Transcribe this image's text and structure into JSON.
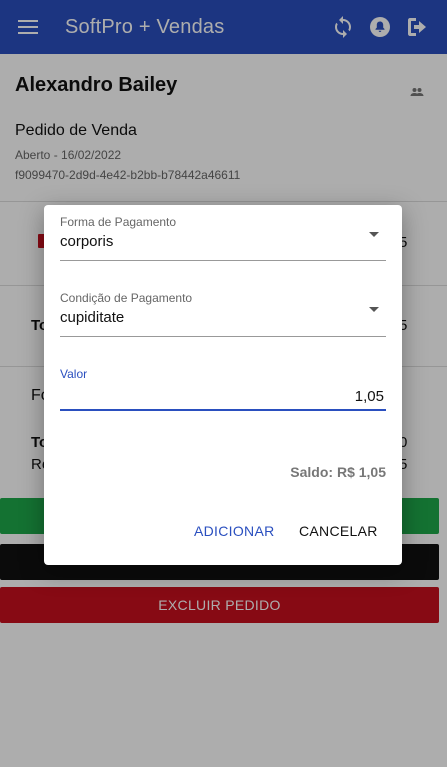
{
  "app": {
    "title": "SoftPro + Vendas",
    "accent_color": "#2a4fbf"
  },
  "header_icons": [
    "menu-icon",
    "sync-icon",
    "bell-icon",
    "logout-icon"
  ],
  "order": {
    "client_name": "Alexandro Bailey",
    "title": "Pedido de Venda",
    "status": "Aberto - 16/02/2022",
    "id": "f9099470-2d9d-4e42-b2bb-b78442a46611"
  },
  "background_fragments": {
    "right_5_a": "5",
    "to_a": "To",
    "right_5_b": "5",
    "fo": "Fo",
    "to_b": "To",
    "right_0": "0",
    "re": "Re",
    "right_5_c": "5"
  },
  "buttons": {
    "delete_order": "EXCLUIR PEDIDO",
    "delete_color": "#c8101e"
  },
  "dialog": {
    "payment_form": {
      "label": "Forma de Pagamento",
      "value": "corporis"
    },
    "payment_condition": {
      "label": "Condição de Pagamento",
      "value": "cupiditate"
    },
    "amount": {
      "label": "Valor",
      "value": "1,05"
    },
    "balance": "Saldo: R$ 1,05",
    "add_label": "ADICIONAR",
    "cancel_label": "CANCELAR"
  }
}
